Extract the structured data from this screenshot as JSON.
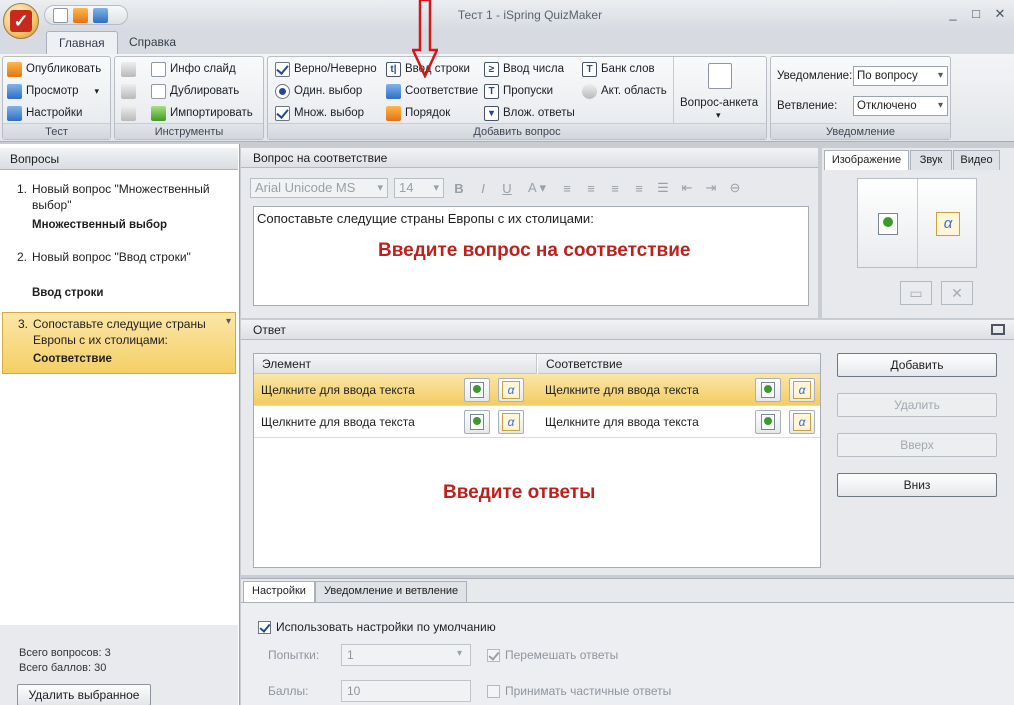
{
  "window": {
    "title": "Тест 1 - iSpring QuizMaker",
    "controls": [
      "_",
      "□",
      "✕"
    ]
  },
  "ribbon_tabs": [
    "Главная",
    "Справка"
  ],
  "groups": {
    "test": {
      "caption": "Тест",
      "items": [
        "Опубликовать",
        "Просмотр",
        "Настройки"
      ]
    },
    "tools": {
      "caption": "Инструменты",
      "items": [
        "Инфо слайд",
        "Дублировать",
        "Импортировать"
      ]
    },
    "add": {
      "caption": "Добавить вопрос",
      "items": [
        "Верно/Неверно",
        "Один. выбор",
        "Множ. выбор",
        "Ввод строки",
        "Соответствие",
        "Порядок",
        "Ввод числа",
        "Пропуски",
        "Влож. ответы",
        "Банк слов",
        "Акт. область"
      ],
      "survey": "Вопрос-анкета"
    },
    "notify": {
      "caption": "Уведомление",
      "notify_label": "Уведомление:",
      "notify_value": "По вопросу",
      "branch_label": "Ветвление:",
      "branch_value": "Отключено"
    }
  },
  "questions": {
    "header": "Вопросы",
    "items": [
      {
        "num": "1.",
        "title": "Новый вопрос \"Множественный выбор\"",
        "type": "Множественный выбор"
      },
      {
        "num": "2.",
        "title": "Новый вопрос \"Ввод строки\"",
        "type": "Ввод строки"
      },
      {
        "num": "3.",
        "title": "Сопоставьте следущие страны Европы с их столицами:",
        "type": "Соответствие"
      }
    ],
    "total_questions": "Всего вопросов: 3",
    "total_points": "Всего баллов: 30",
    "delete_button": "Удалить выбранное"
  },
  "question_panel": {
    "header": "Вопрос на соответствие",
    "font": "Arial Unicode MS",
    "size": "14",
    "text": "Сопоставьте следущие страны Европы с их столицами:",
    "hint": "Введите вопрос на соответствие"
  },
  "media_tabs": [
    "Изображение",
    "Звук",
    "Видео"
  ],
  "answer_panel": {
    "header": "Ответ",
    "col_element": "Элемент",
    "col_match": "Соответствие",
    "rows": [
      {
        "left": "Щелкните для ввода текста",
        "right": "Щелкните для ввода текста"
      },
      {
        "left": "Щелкните для ввода текста",
        "right": "Щелкните для ввода текста"
      }
    ],
    "hint": "Введите ответы",
    "buttons": [
      "Добавить",
      "Удалить",
      "Вверх",
      "Вниз"
    ]
  },
  "settings": {
    "tabs": [
      "Настройки",
      "Уведомление и ветвление"
    ],
    "use_default": "Использовать настройки по умолчанию",
    "attempts_label": "Попытки:",
    "attempts_value": "1",
    "shuffle": "Перемешать ответы",
    "points_label": "Баллы:",
    "points_value": "10",
    "partial": "Принимать частичные ответы"
  },
  "colors": {
    "accent_selected": "#f5cf66",
    "hint_red": "#c0201b",
    "arrow_red": "#d01818"
  }
}
